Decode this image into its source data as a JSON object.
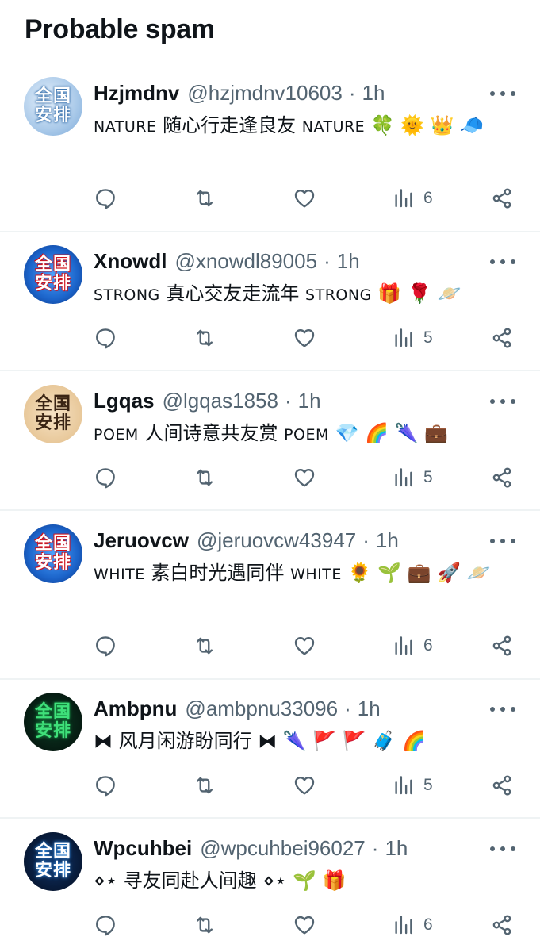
{
  "page": {
    "title": "Probable spam"
  },
  "tweets": [
    {
      "name": "Hzjmdnv",
      "handle": "@hzjmdnv10603",
      "time": "1h",
      "avatar_text": [
        "全国",
        "安排"
      ],
      "avatar_style": "snow",
      "text_parts": [
        {
          "t": "NATURE",
          "caps": true
        },
        {
          "t": " 随心行走逢良友 "
        },
        {
          "t": "NATURE",
          "caps": true
        },
        {
          "t": " 🍀 🌞 👑 🧢"
        }
      ],
      "views": "6"
    },
    {
      "name": "Xnowdl",
      "handle": "@xnowdl89005",
      "time": "1h",
      "avatar_text": [
        "全国",
        "安排"
      ],
      "avatar_style": "blue",
      "text_parts": [
        {
          "t": "STRONG",
          "caps": true
        },
        {
          "t": " 真心交友走流年 "
        },
        {
          "t": "STRONG",
          "caps": true
        },
        {
          "t": " 🎁 🌹 🪐"
        }
      ],
      "views": "5"
    },
    {
      "name": "Lgqas",
      "handle": "@lgqas1858",
      "time": "1h",
      "avatar_text": [
        "全国",
        "安排"
      ],
      "avatar_style": "beige",
      "text_parts": [
        {
          "t": "POEM",
          "caps": true
        },
        {
          "t": " 人间诗意共友赏 "
        },
        {
          "t": "POEM",
          "caps": true
        },
        {
          "t": " 💎 🌈 🌂 💼"
        }
      ],
      "views": "5"
    },
    {
      "name": "Jeruovcw",
      "handle": "@jeruovcw43947",
      "time": "1h",
      "avatar_text": [
        "全国",
        "安排"
      ],
      "avatar_style": "blue",
      "text_parts": [
        {
          "t": "WHITE",
          "caps": true
        },
        {
          "t": " 素白时光遇同伴 "
        },
        {
          "t": "WHITE",
          "caps": true
        },
        {
          "t": " 🌻 🌱 💼 🚀 🪐"
        }
      ],
      "views": "6"
    },
    {
      "name": "Ambpnu",
      "handle": "@ambpnu33096",
      "time": "1h",
      "avatar_text": [
        "全国",
        "安排"
      ],
      "avatar_style": "green",
      "text_parts": [
        {
          "t": "⧓"
        },
        {
          "t": " 风月闲游盼同行 "
        },
        {
          "t": "⧓"
        },
        {
          "t": " 🌂 🚩 🚩 🧳 🌈"
        }
      ],
      "views": "5"
    },
    {
      "name": "Wpcuhbei",
      "handle": "@wpcuhbei96027",
      "time": "1h",
      "avatar_text": [
        "全国",
        "安排"
      ],
      "avatar_style": "navy",
      "text_parts": [
        {
          "t": "⋄⋆"
        },
        {
          "t": " 寻友同赴人间趣 "
        },
        {
          "t": "⋄⋆"
        },
        {
          "t": " 🌱 🎁"
        }
      ],
      "views": "6"
    }
  ]
}
